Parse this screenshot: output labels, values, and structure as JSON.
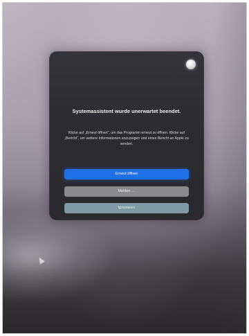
{
  "dialog": {
    "title": "Systemassistent wurde unerwartet beendet.",
    "message": "Klicke auf „Erneut öffnen“, um das Programm erneut zu öffnen. Klicke auf „Bericht“, um weitere Informationen anzuzeigen und einen Bericht an Apple zu senden.",
    "buttons": {
      "reopen": "Erneut öffnen",
      "report": "Melden …",
      "ignore": "Ignorieren"
    },
    "icon": "app-icon"
  },
  "colors": {
    "primary_button": "#1f6fe8",
    "dialog_background": "#2f2e33"
  }
}
